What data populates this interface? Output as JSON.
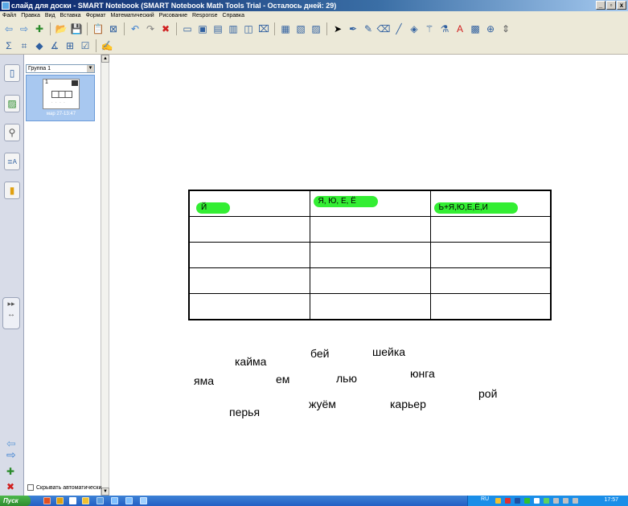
{
  "window": {
    "title": "слайд для доски - SMART Notebook (SMART Notebook Math Tools Trial - Осталось дней: 29)",
    "buttons": [
      "_",
      "▫",
      "x"
    ]
  },
  "menu": [
    "Файл",
    "Правка",
    "Вид",
    "Вставка",
    "Формат",
    "Математический",
    "Рисование",
    "Response",
    "Справка"
  ],
  "toolbar1": [
    {
      "icon": "back-arrow-icon",
      "glyph": "⇦",
      "color": "#3b7fd0"
    },
    {
      "icon": "forward-arrow-icon",
      "glyph": "⇨",
      "color": "#3b7fd0"
    },
    {
      "icon": "add-page-icon",
      "glyph": "✚",
      "color": "#2a8a2a"
    },
    {
      "icon": "open-folder-icon",
      "glyph": "📂",
      "color": "#c89a20"
    },
    {
      "icon": "save-icon",
      "glyph": "💾",
      "color": "#3060a0"
    },
    {
      "icon": "paste-icon",
      "glyph": "📋",
      "color": "#606060"
    },
    {
      "icon": "delete-icon",
      "glyph": "⊠",
      "color": "#3060a0"
    },
    {
      "icon": "undo-icon",
      "glyph": "↶",
      "color": "#3b7fd0"
    },
    {
      "icon": "redo-icon",
      "glyph": "↷",
      "color": "#808080"
    },
    {
      "icon": "delete-object-icon",
      "glyph": "✖",
      "color": "#d02020"
    },
    {
      "icon": "screen-shade-icon",
      "glyph": "▭",
      "color": "#3060a0"
    },
    {
      "icon": "full-screen-icon",
      "glyph": "▣",
      "color": "#3060a0"
    },
    {
      "icon": "transparent-bg-icon",
      "glyph": "▤",
      "color": "#3060a0"
    },
    {
      "icon": "dual-page-icon",
      "glyph": "▥",
      "color": "#3060a0"
    },
    {
      "icon": "screen-capture-icon",
      "glyph": "◫",
      "color": "#3060a0"
    },
    {
      "icon": "document-camera-icon",
      "glyph": "⌧",
      "color": "#3060a0"
    },
    {
      "icon": "table-icon",
      "glyph": "▦",
      "color": "#3060a0"
    },
    {
      "icon": "insert-table-icon",
      "glyph": "▧",
      "color": "#3060a0"
    },
    {
      "icon": "properties-icon",
      "glyph": "▨",
      "color": "#3060a0"
    },
    {
      "icon": "select-arrow-icon",
      "glyph": "➤",
      "color": "#000000"
    },
    {
      "icon": "pen-icon",
      "glyph": "✒",
      "color": "#3060a0"
    },
    {
      "icon": "creative-pen-icon",
      "glyph": "✎",
      "color": "#3060a0"
    },
    {
      "icon": "eraser-icon",
      "glyph": "⌫",
      "color": "#3060a0"
    },
    {
      "icon": "line-icon",
      "glyph": "╱",
      "color": "#3060a0"
    },
    {
      "icon": "fill-icon",
      "glyph": "◈",
      "color": "#3060a0"
    },
    {
      "icon": "magic-pen-icon",
      "glyph": "⚚",
      "color": "#3060a0"
    },
    {
      "icon": "shape-recognition-icon",
      "glyph": "⚗",
      "color": "#3060a0"
    },
    {
      "icon": "text-icon",
      "glyph": "A",
      "color": "#d02020"
    },
    {
      "icon": "font-icon",
      "glyph": "▩",
      "color": "#3060a0"
    },
    {
      "icon": "cursor-icon",
      "glyph": "⊕",
      "color": "#3060a0"
    },
    {
      "icon": "toolbar-more-icon",
      "glyph": "⇕",
      "color": "#606060"
    }
  ],
  "toolbar2": [
    {
      "icon": "sigma-icon",
      "glyph": "Σ",
      "color": "#3060a0"
    },
    {
      "icon": "graph-icon",
      "glyph": "⌗",
      "color": "#3060a0"
    },
    {
      "icon": "shape-icon",
      "glyph": "◆",
      "color": "#3060a0"
    },
    {
      "icon": "angle-icon",
      "glyph": "∡",
      "color": "#3060a0"
    },
    {
      "icon": "math-table-icon",
      "glyph": "⊞",
      "color": "#3060a0"
    },
    {
      "icon": "checkbox-icon",
      "glyph": "☑",
      "color": "#3060a0"
    },
    {
      "icon": "handwriting-icon",
      "glyph": "✍",
      "color": "#3060a0"
    }
  ],
  "sorter": {
    "group_label": "Группа 1",
    "page_number": "1",
    "page_date": "мар 27-13:47",
    "autohide_label": "Скрывать автоматически"
  },
  "table": {
    "header": [
      "Й",
      "Я, Ю, Е, Ё",
      "Ь+Я,Ю,Е,Ё,И"
    ],
    "highlight_color": "#33ee33"
  },
  "words": [
    "кайма",
    "бей",
    "шейка",
    "яма",
    "ем",
    "лью",
    "юнга",
    "рой",
    "перья",
    "жуём",
    "карьер"
  ],
  "taskbar": {
    "start_label": "Пуск",
    "lang": "RU",
    "clock": "17:57"
  }
}
